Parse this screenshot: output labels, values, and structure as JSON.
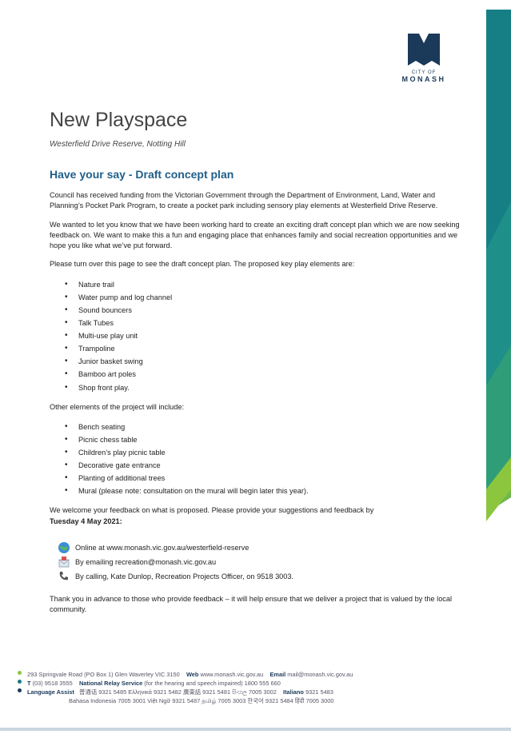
{
  "logo": {
    "city_of": "CITY OF",
    "name": "MONASH"
  },
  "title": "New Playspace",
  "subtitle": "Westerfield Drive Reserve, Notting Hill",
  "heading": "Have your say - Draft concept plan",
  "paragraphs": {
    "p1": "Council has received funding from the Victorian Government through the Department of Environment, Land, Water and Planning’s Pocket Park Program, to create a pocket park including sensory play elements at Westerfield Drive Reserve.",
    "p2": "We wanted to let you know that we have been working hard to create an exciting draft concept plan which we are now seeking feedback on. We want to make this a fun and engaging place that enhances family and social recreation opportunities and we hope you like what we’ve put forward.",
    "p3": "Please turn over this page to see the draft concept plan. The proposed key play elements are:",
    "p4": "Other elements of the project will include:",
    "p5": "We welcome your feedback on what is proposed. Please provide your suggestions and feedback by",
    "deadline": "Tuesday 4 May 2021:",
    "p6": "Thank you in advance to those who provide feedback – it will help ensure that we deliver a project that is valued by the local community."
  },
  "play_elements": [
    "Nature trail",
    "Water pump and log channel",
    "Sound bouncers",
    "Talk Tubes",
    "Multi-use play unit",
    "Trampoline",
    "Junior basket swing",
    "Bamboo art poles",
    "Shop front play."
  ],
  "other_elements": [
    "Bench seating",
    "Picnic chess table",
    "Children’s play picnic table",
    "Decorative gate entrance",
    "Planting of additional trees",
    "Mural (please note: consultation on the mural will begin later this year)."
  ],
  "contacts": {
    "online": "Online at www.monash.vic.gov.au/westerfield-reserve",
    "email": "By emailing recreation@monash.vic.gov.au",
    "phone": "By calling, Kate Dunlop, Recreation Projects Officer, on 9518 3003."
  },
  "footer": {
    "address": "293 Springvale Road (PO Box 1) Glen Waverley VIC 3150",
    "web_label": "Web",
    "web": "www.monash.vic.gov.au",
    "email_label": "Email",
    "email": "mail@monash.vic.gov.au",
    "tel_label": "T",
    "tel": "(03) 9518 3555",
    "relay_label": "National Relay Service",
    "relay": "(for the hearing and speech impaired)  1800 555 660",
    "language_label": "Language Assist",
    "languages_row1": "普通话  9321 5485   Ελληνικά  9321 5482   廣東話  9321 5481   සිංහල  7005 3002",
    "italiano_label": "Italiano",
    "italiano": "9321 5483",
    "languages_row2": "Bahasa Indonesia  7005 3001   Việt Ngữ  9321 5487   தமிழ்  7005 3003   한국어  9321 5484   हिंदी  7005 3000"
  },
  "colors": {
    "heading": "#1f5e8a",
    "logo": "#1b3a5a",
    "band_teal": "#1a7a86",
    "band_green": "#8cc63f"
  }
}
